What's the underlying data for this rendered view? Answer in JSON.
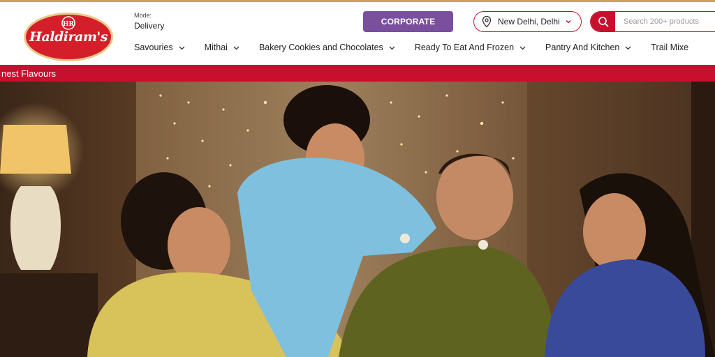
{
  "header": {
    "logo_text": "Haldiram's",
    "mode_label": "Mode:",
    "mode_value": "Delivery",
    "corporate_label": "CORPORATE",
    "location": "New Delhi, Delhi",
    "search_placeholder": "Search 200+ products"
  },
  "nav": {
    "items": [
      {
        "label": "Savouries"
      },
      {
        "label": "Mithai"
      },
      {
        "label": "Bakery Cookies and Chocolates"
      },
      {
        "label": "Ready To Eat And Frozen"
      },
      {
        "label": "Pantry And Kitchen"
      },
      {
        "label": "Trail Mixe"
      }
    ]
  },
  "banner": {
    "text": "nest Flavours"
  },
  "colors": {
    "brand_red": "#c8102e",
    "corporate_purple": "#7a4f9e",
    "gold_line": "#c8a45a"
  },
  "icons": [
    "location-pin-icon",
    "chevron-down-icon",
    "search-icon"
  ]
}
